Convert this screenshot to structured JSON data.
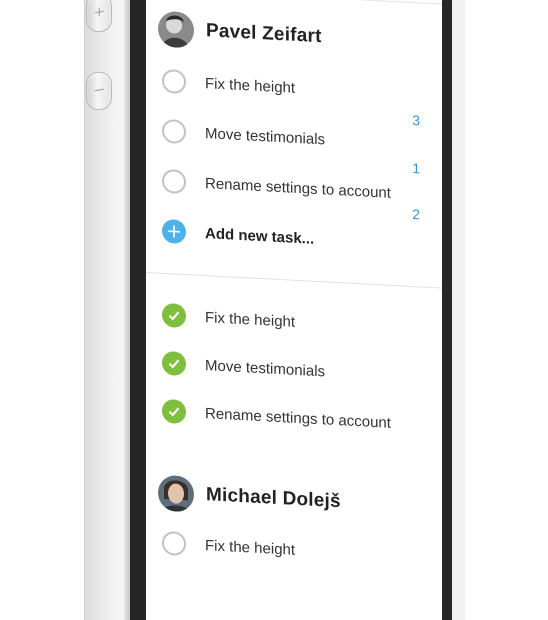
{
  "users": [
    {
      "name": "Pavel Zeifart",
      "pending_tasks": [
        {
          "label": "Fix the height",
          "count": "3"
        },
        {
          "label": "Move testimonials",
          "count": "1"
        },
        {
          "label": "Rename settings to account",
          "count": "2"
        }
      ],
      "add_task_label": "Add new task...",
      "completed_tasks": [
        {
          "label": "Fix the height"
        },
        {
          "label": "Move testimonials"
        },
        {
          "label": "Rename settings to account"
        }
      ]
    },
    {
      "name": "Michael Dolejš",
      "pending_tasks": [
        {
          "label": "Fix the height"
        }
      ]
    }
  ],
  "icons": {
    "unchecked": "circle-outline",
    "checked": "check-circle",
    "add": "plus-circle"
  },
  "colors": {
    "check_green": "#7fbf3f",
    "add_blue": "#4db3e6",
    "count_blue": "#3a98d6",
    "bezel": "#262626"
  }
}
